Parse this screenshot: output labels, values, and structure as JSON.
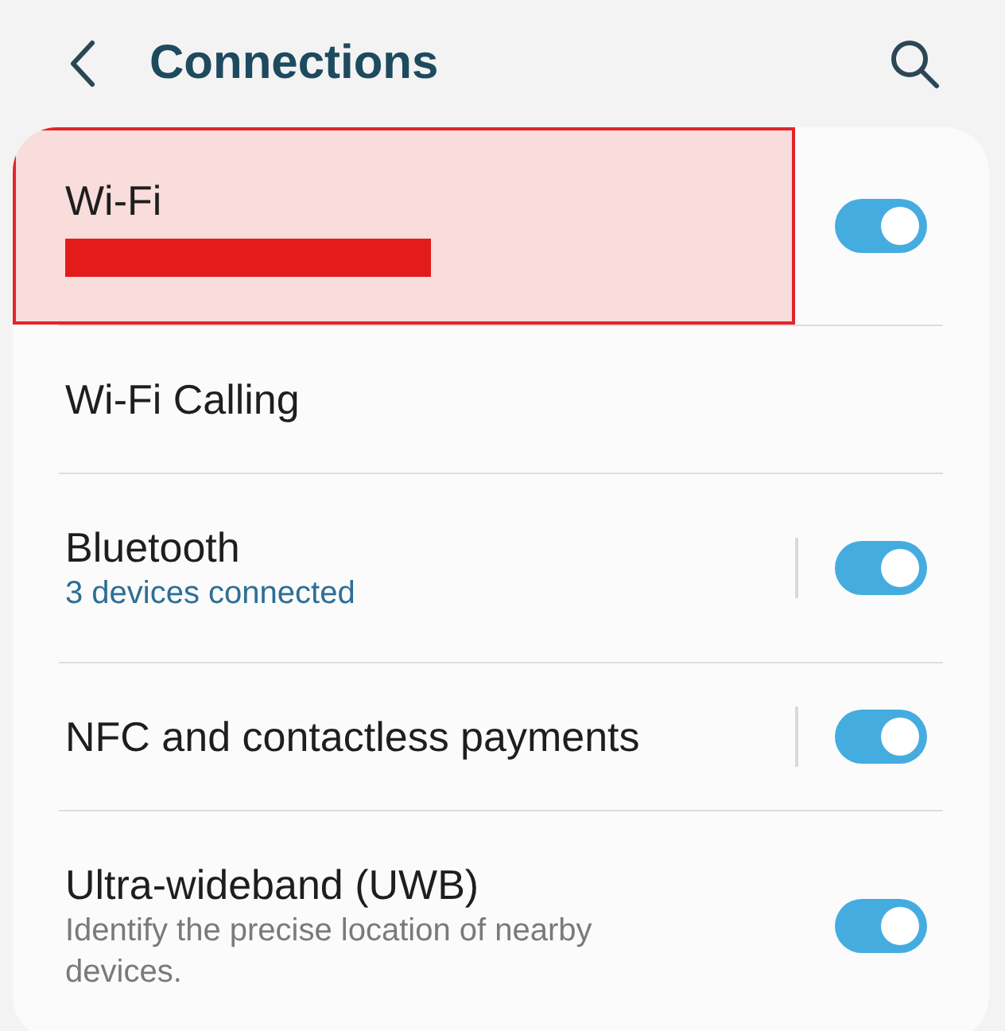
{
  "header": {
    "title": "Connections"
  },
  "items": [
    {
      "title": "Wi-Fi",
      "kind": "toggle",
      "on": true,
      "split": false,
      "highlighted": true,
      "redacted": true
    },
    {
      "title": "Wi-Fi Calling",
      "kind": "plain",
      "highlighted": false,
      "redacted": false
    },
    {
      "title": "Bluetooth",
      "kind": "toggle",
      "on": true,
      "split": true,
      "highlighted": false,
      "redacted": false,
      "subtitle": {
        "text": "3 devices connected",
        "kind": "status"
      }
    },
    {
      "title": "NFC and contactless payments",
      "kind": "toggle",
      "on": true,
      "split": true,
      "highlighted": false,
      "redacted": false
    },
    {
      "title": "Ultra-wideband (UWB)",
      "kind": "toggle",
      "on": true,
      "split": false,
      "highlighted": false,
      "redacted": false,
      "subtitle": {
        "text": "Identify the precise location of nearby devices.",
        "kind": "description"
      }
    }
  ]
}
